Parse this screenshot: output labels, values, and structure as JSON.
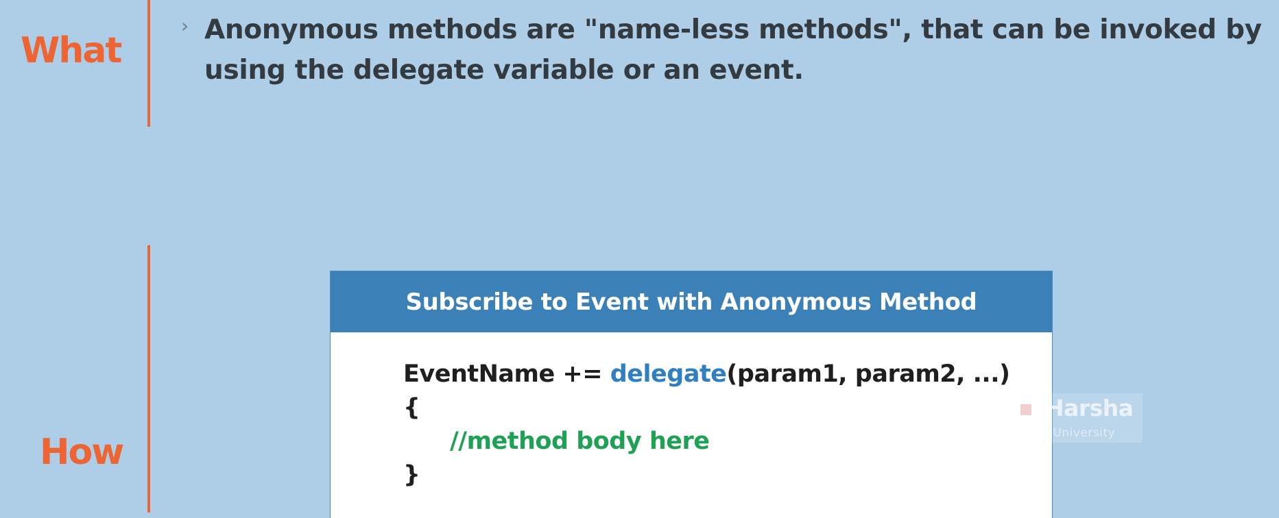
{
  "sections": {
    "what": {
      "label": "What",
      "bullet": "›",
      "text_lines": [
        "Anonymous methods are \"name-less methods\", that can be invoked by",
        "using the delegate variable or an event."
      ]
    },
    "how": {
      "label": "How"
    }
  },
  "card": {
    "title": "Subscribe to Event with Anonymous Method",
    "code": {
      "line1_prefix": "EventName += ",
      "line1_keyword": "delegate",
      "line1_suffix": "(param1, param2, ...)",
      "open_brace": "{",
      "comment": "//method body here",
      "close_brace": "}"
    }
  },
  "watermark": {
    "name": "Harsha",
    "subtitle": "Web University"
  },
  "colors": {
    "background": "#aecde6",
    "accent_orange": "#ec6533",
    "card_header": "#3b80b7",
    "keyword_blue": "#2f7fc1",
    "comment_green": "#1ea154"
  }
}
